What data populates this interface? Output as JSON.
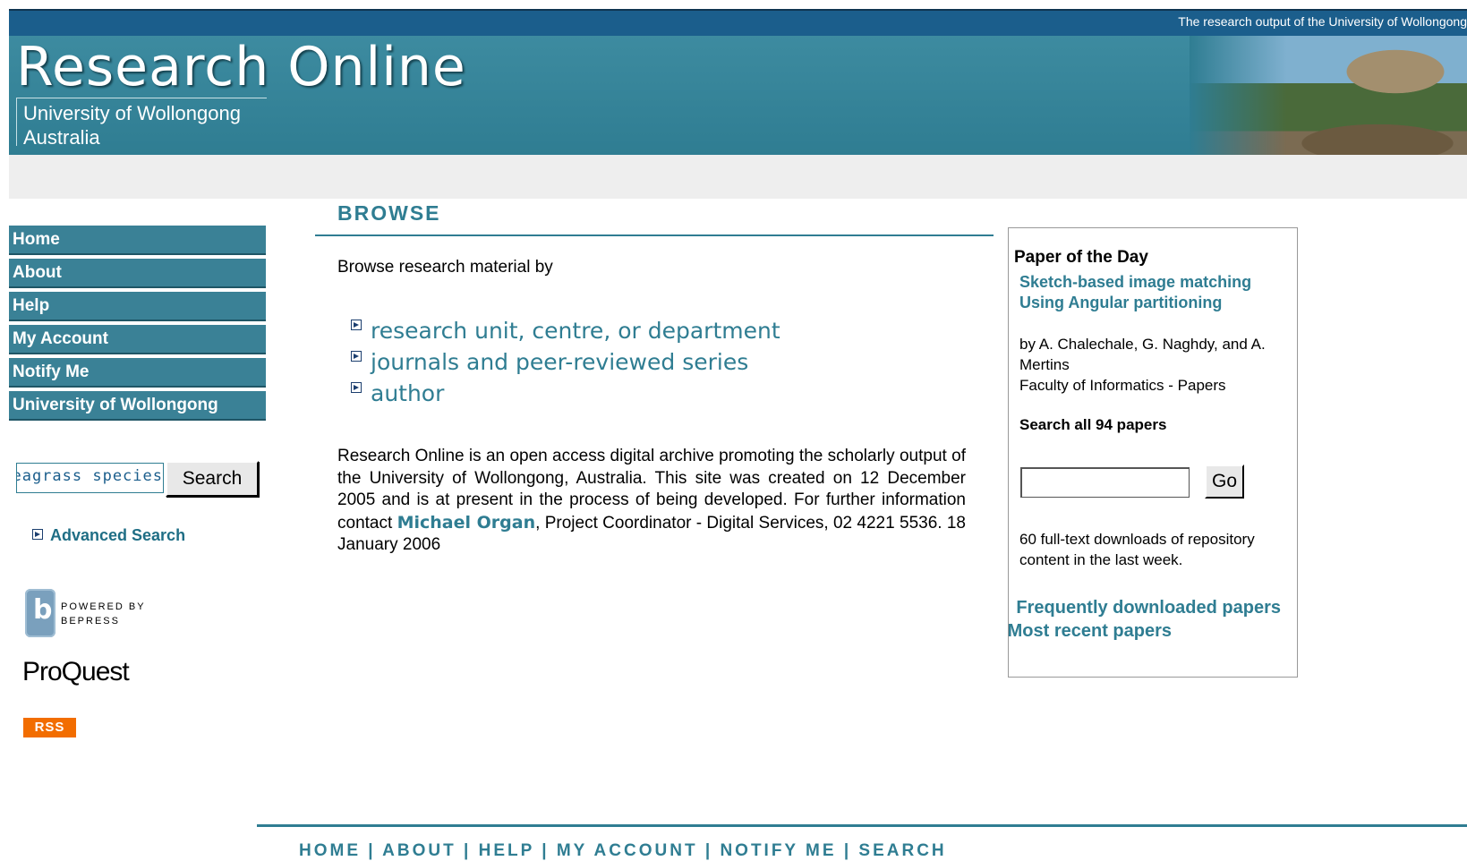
{
  "header": {
    "tagline": "The research  output of the University of Wollongong",
    "title": "Research Online",
    "subtitle_line1": "University of Wollongong",
    "subtitle_line2": "Australia"
  },
  "nav": {
    "items": [
      {
        "label": "Home"
      },
      {
        "label": "About"
      },
      {
        "label": "Help"
      },
      {
        "label": "My Account"
      },
      {
        "label": "Notify Me"
      },
      {
        "label": "University of Wollongong"
      }
    ]
  },
  "search": {
    "value": "seagrass species",
    "button_label": "Search",
    "advanced_label": "Advanced Search"
  },
  "logos": {
    "bepress_line1": "POWERED BY",
    "bepress_line2": "BEPRESS",
    "bepress_letter": "b",
    "proquest": "ProQuest",
    "rss": "RSS"
  },
  "main": {
    "heading": "BROWSE",
    "intro": "Browse research material by",
    "browse_links": [
      {
        "label": "research unit, centre, or department"
      },
      {
        "label": "journals and peer-reviewed series"
      },
      {
        "label": "author"
      }
    ],
    "description_part1": "Research Online is an open access digital archive promoting the scholarly output of the University of Wollongong, Australia. This site was created on 12 December 2005 and is at present in the process of being developed. For further information contact ",
    "contact_name": "Michael Organ",
    "description_part2": ", Project Coordinator - Digital Services, 02 4221 5536. 18 January 2006"
  },
  "sidebar_right": {
    "heading": "Paper of the Day",
    "paper_title": "Sketch-based image matching Using Angular partitioning",
    "authors": "by A. Chalechale, G. Naghdy, and A. Mertins",
    "series": "Faculty of Informatics - Papers",
    "search_all": "Search all 94 papers",
    "go_label": "Go",
    "downloads": "60 full-text downloads of repository content in the last week.",
    "frequent_link": "Frequently downloaded papers",
    "recent_link": "Most recent papers"
  },
  "footer": {
    "links": [
      "HOME",
      "ABOUT",
      "HELP",
      "MY ACCOUNT",
      "NOTIFY ME",
      "SEARCH"
    ],
    "separator": " | "
  },
  "colors": {
    "accent": "#2f7d92",
    "topbar": "#1b5e8c",
    "rss": "#f26d00"
  }
}
